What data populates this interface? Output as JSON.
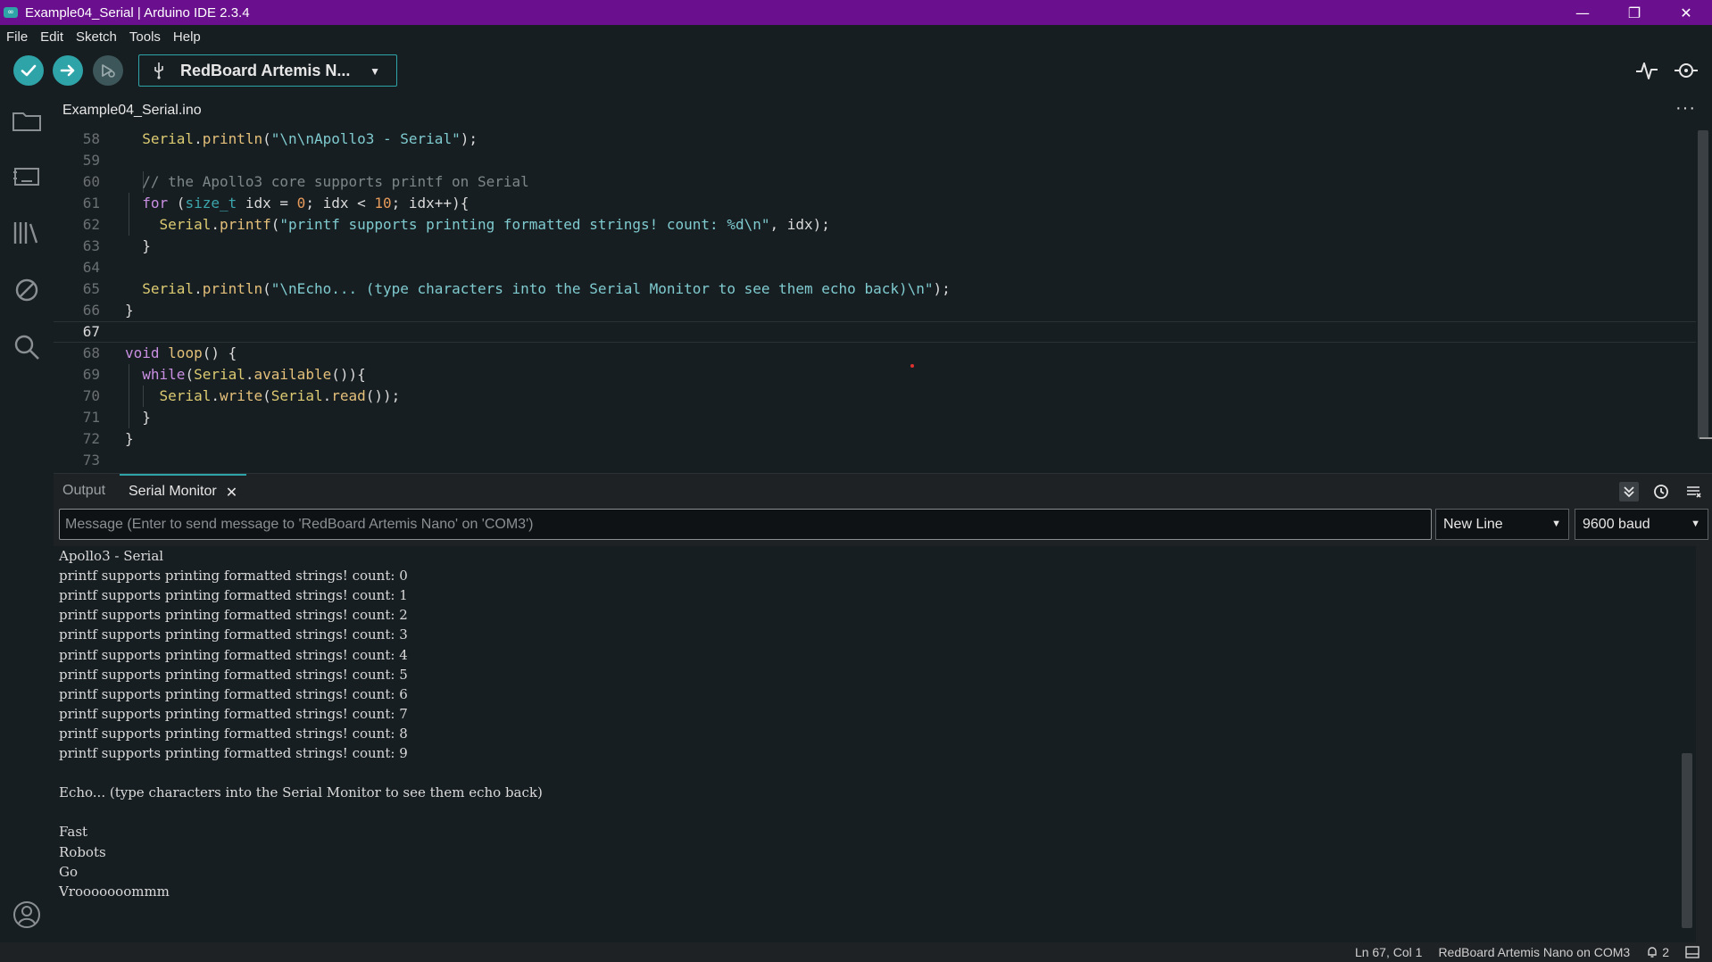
{
  "window": {
    "title": "Example04_Serial | Arduino IDE 2.3.4",
    "app_icon_glyph": "∞",
    "controls": {
      "minimize": "—",
      "maximize": "❐",
      "close": "✕"
    }
  },
  "menu": [
    "File",
    "Edit",
    "Sketch",
    "Tools",
    "Help"
  ],
  "toolbar": {
    "verify_icon": "check-icon",
    "upload_icon": "arrow-right-icon",
    "debug_icon": "debug-icon",
    "board_label": "RedBoard Artemis N...",
    "board_caret": "▼",
    "plotter_icon": "serial-plotter-icon",
    "monitor_icon": "serial-monitor-icon"
  },
  "sidebar": [
    "sketchbook-icon",
    "boards-manager-icon",
    "library-manager-icon",
    "debug-icon",
    "search-icon",
    "account-icon"
  ],
  "editor": {
    "file_tab": "Example04_Serial.ino",
    "more": "···",
    "lines": [
      {
        "n": "58",
        "parts": [
          [
            "code",
            "  "
          ],
          [
            "c-obj",
            "Serial"
          ],
          [
            "code",
            "."
          ],
          [
            "c-fn",
            "println"
          ],
          [
            "code",
            "("
          ],
          [
            "c-str",
            "\"\\n\\nApollo3 - Serial\""
          ],
          [
            "code",
            ");"
          ]
        ]
      },
      {
        "n": "59",
        "parts": []
      },
      {
        "n": "60",
        "parts": [
          [
            "code",
            "  "
          ],
          [
            "c-com",
            "// the Apollo3 core supports printf on Serial"
          ]
        ]
      },
      {
        "n": "61",
        "parts": [
          [
            "code",
            "  "
          ],
          [
            "c-kw",
            "for"
          ],
          [
            "code",
            " ("
          ],
          [
            "c-type",
            "size_t"
          ],
          [
            "code",
            " idx = "
          ],
          [
            "c-num",
            "0"
          ],
          [
            "code",
            "; idx < "
          ],
          [
            "c-num",
            "10"
          ],
          [
            "code",
            "; idx++){"
          ]
        ]
      },
      {
        "n": "62",
        "parts": [
          [
            "code",
            "    "
          ],
          [
            "c-obj",
            "Serial"
          ],
          [
            "code",
            "."
          ],
          [
            "c-fn",
            "printf"
          ],
          [
            "code",
            "("
          ],
          [
            "c-str",
            "\"printf supports printing formatted strings! count: %d\\n\""
          ],
          [
            "code",
            ", idx);"
          ]
        ]
      },
      {
        "n": "63",
        "parts": [
          [
            "code",
            "  }"
          ]
        ]
      },
      {
        "n": "64",
        "parts": []
      },
      {
        "n": "65",
        "parts": [
          [
            "code",
            "  "
          ],
          [
            "c-obj",
            "Serial"
          ],
          [
            "code",
            "."
          ],
          [
            "c-fn",
            "println"
          ],
          [
            "code",
            "("
          ],
          [
            "c-str",
            "\"\\nEcho... (type characters into the Serial Monitor to see them echo back)\\n\""
          ],
          [
            "code",
            ");"
          ]
        ]
      },
      {
        "n": "66",
        "parts": [
          [
            "code",
            "}"
          ]
        ]
      },
      {
        "n": "67",
        "parts": []
      },
      {
        "n": "68",
        "parts": [
          [
            "c-kw",
            "void"
          ],
          [
            "code",
            " "
          ],
          [
            "c-fn",
            "loop"
          ],
          [
            "code",
            "() {"
          ]
        ]
      },
      {
        "n": "69",
        "parts": [
          [
            "code",
            "  "
          ],
          [
            "c-kw",
            "while"
          ],
          [
            "code",
            "("
          ],
          [
            "c-obj",
            "Serial"
          ],
          [
            "code",
            "."
          ],
          [
            "c-fn",
            "available"
          ],
          [
            "code",
            "()){"
          ]
        ]
      },
      {
        "n": "70",
        "parts": [
          [
            "code",
            "    "
          ],
          [
            "c-obj",
            "Serial"
          ],
          [
            "code",
            "."
          ],
          [
            "c-fn",
            "write"
          ],
          [
            "code",
            "("
          ],
          [
            "c-obj",
            "Serial"
          ],
          [
            "code",
            "."
          ],
          [
            "c-fn",
            "read"
          ],
          [
            "code",
            "());"
          ]
        ]
      },
      {
        "n": "71",
        "parts": [
          [
            "code",
            "  }"
          ]
        ]
      },
      {
        "n": "72",
        "parts": [
          [
            "code",
            "}"
          ]
        ]
      },
      {
        "n": "73",
        "parts": []
      }
    ],
    "active_line": "67"
  },
  "panel": {
    "tab_output": "Output",
    "tab_serial": "Serial Monitor",
    "close_glyph": "✕",
    "autoscroll_icon": "autoscroll-icon",
    "timestamp_icon": "clock-icon",
    "clear_icon": "clear-output-icon",
    "message_placeholder": "Message (Enter to send message to 'RedBoard Artemis Nano' on 'COM3')",
    "line_ending": "New Line",
    "baud": "9600 baud",
    "caret": "▼"
  },
  "serial_output": [
    "Apollo3 - Serial",
    "printf supports printing formatted strings! count: 0",
    "printf supports printing formatted strings! count: 1",
    "printf supports printing formatted strings! count: 2",
    "printf supports printing formatted strings! count: 3",
    "printf supports printing formatted strings! count: 4",
    "printf supports printing formatted strings! count: 5",
    "printf supports printing formatted strings! count: 6",
    "printf supports printing formatted strings! count: 7",
    "printf supports printing formatted strings! count: 8",
    "printf supports printing formatted strings! count: 9",
    "",
    "Echo... (type characters into the Serial Monitor to see them echo back)",
    "",
    "Fast",
    "Robots",
    "Go",
    "Vrooooooommm"
  ],
  "status": {
    "cursor": "Ln 67, Col 1",
    "board_port": "RedBoard Artemis Nano on COM3",
    "notifications": "2",
    "notification_icon": "bell-icon",
    "panel_toggle_icon": "panel-toggle-icon"
  },
  "colors": {
    "accent": "#2fa4a8",
    "titlebar": "#6a0f8e",
    "background": "#171e21"
  }
}
